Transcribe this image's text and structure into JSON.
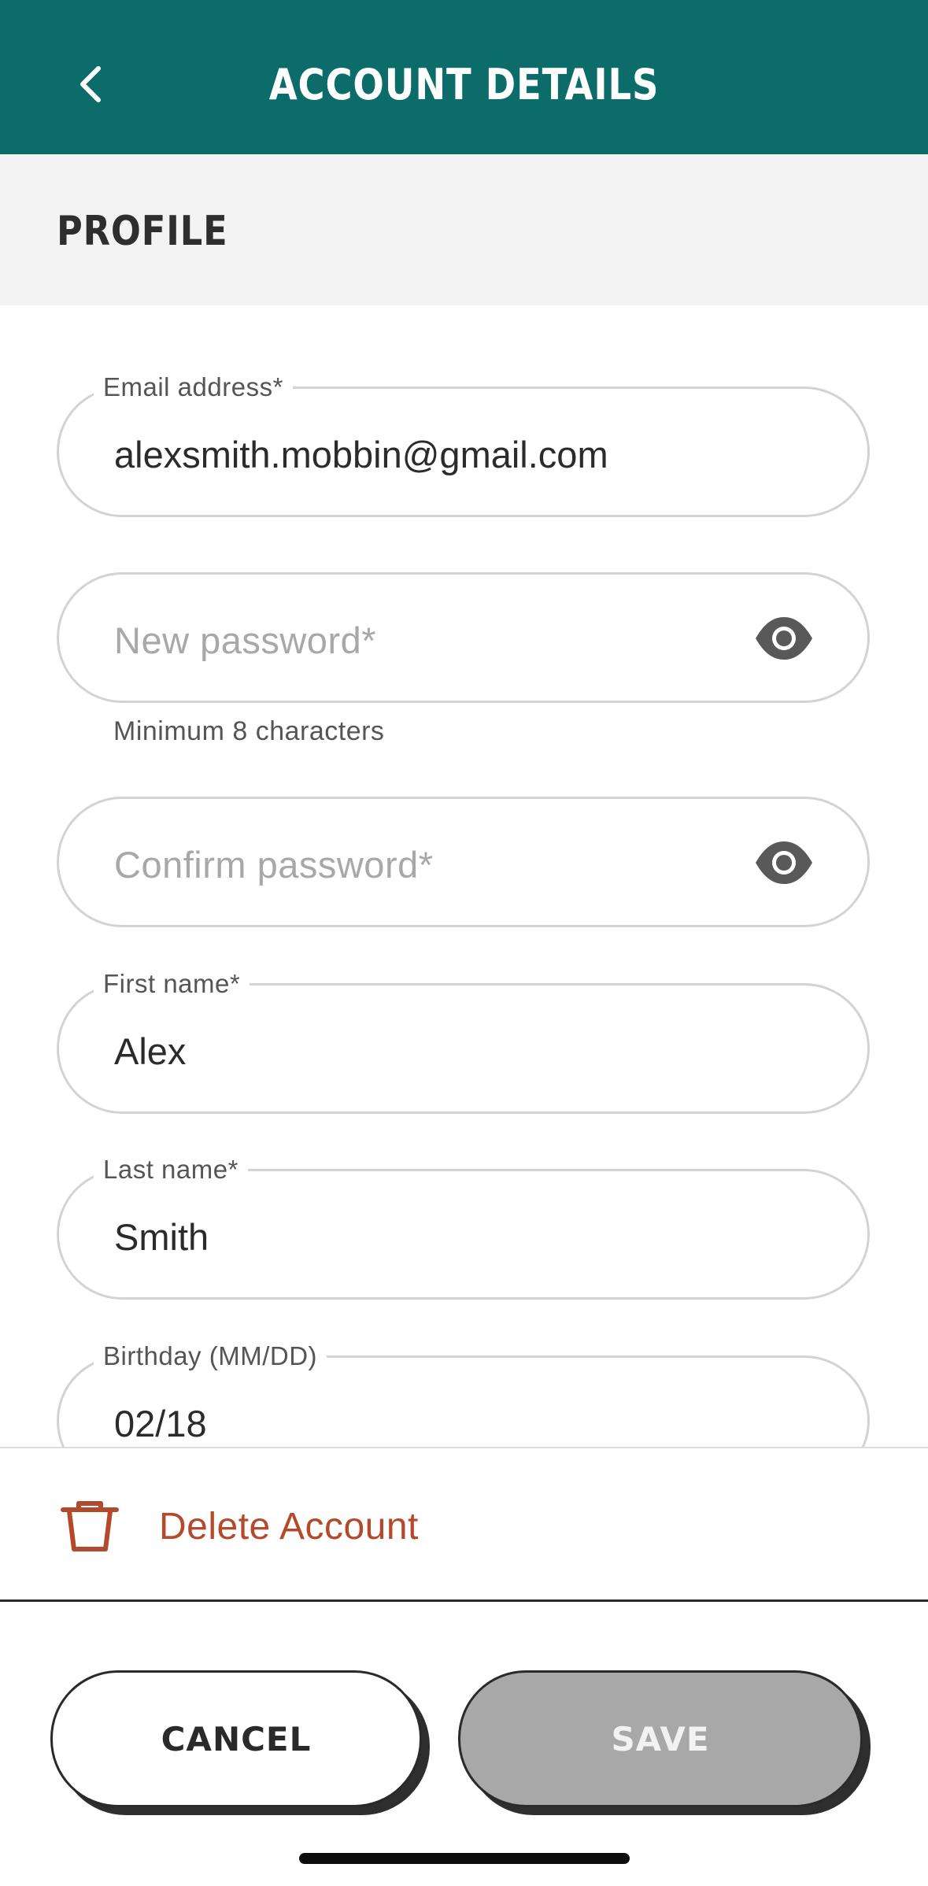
{
  "header": {
    "title": "ACCOUNT DETAILS",
    "back_icon": "chevron-left-icon",
    "background_color": "#0c6c6a"
  },
  "section": {
    "title": "PROFILE"
  },
  "form": {
    "email": {
      "label": "Email address*",
      "value": "alexsmith.mobbin@gmail.com"
    },
    "new_password": {
      "placeholder": "New password*",
      "helper": "Minimum 8 characters",
      "icon": "eye-icon"
    },
    "confirm_password": {
      "placeholder": "Confirm password*",
      "icon": "eye-icon"
    },
    "first_name": {
      "label": "First name*",
      "value": "Alex"
    },
    "last_name": {
      "label": "Last name*",
      "value": "Smith"
    },
    "birthday": {
      "label": "Birthday (MM/DD)",
      "value": "02/18"
    }
  },
  "delete": {
    "label": "Delete Account",
    "icon": "trash-icon",
    "color": "#b44a2c"
  },
  "actions": {
    "cancel_label": "CANCEL",
    "save_label": "SAVE",
    "save_disabled_color": "#a7a8a7"
  }
}
